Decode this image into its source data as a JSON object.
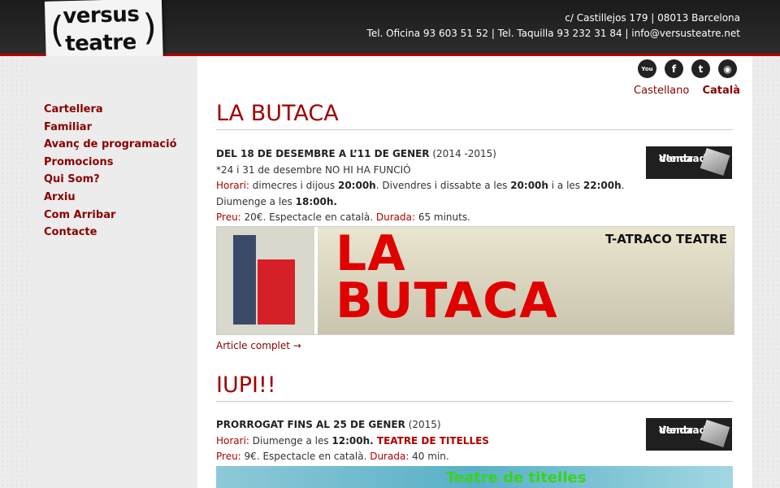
{
  "header": {
    "logo_top": "versus",
    "logo_bottom": "teatre",
    "address": "c/ Castillejos 179 | 08013 Barcelona",
    "phones": "Tel. Oficina 93 603 51 52 | Tel. Taquilla 93 232 31 84 | info@versusteatre.net"
  },
  "social": [
    {
      "icon": "youtube-icon",
      "glyph": "You"
    },
    {
      "icon": "facebook-icon",
      "glyph": "f"
    },
    {
      "icon": "twitter-icon",
      "glyph": "t"
    },
    {
      "icon": "rss-icon",
      "glyph": "◉"
    }
  ],
  "languages": {
    "castellano": "Castellano",
    "catala": "Català"
  },
  "nav": [
    "Cartellera",
    "Familiar",
    "Avanç de programació",
    "Promocions",
    "Qui Som?",
    "Arxiu",
    "Com Arribar",
    "Contacte"
  ],
  "events": [
    {
      "title": "LA BUTACA",
      "dates": "DEL 18 DE DESEMBRE A L’11 DE GENER",
      "years": " (2014 -2015)",
      "note": "*24 i 31 de desembre NO HI HA FUNCIÓ",
      "horari_label": "Horari:",
      "horari_1": " dimecres i dijous ",
      "h1": "20:00h",
      "horari_2": ". Divendres i dissabte  a les ",
      "h2": "20:00h",
      "horari_3": " i a les ",
      "h3": "22:00h",
      "horari_4": ".",
      "diumenge": "Diumenge a les ",
      "h4": "18:00h.",
      "preu_label": "Preu:",
      "preu": " 20€. Espectacle en català. ",
      "durada_label": "Durada:",
      "durada": " 65 minuts.",
      "banner_title_1": "LA",
      "banner_title_2": "BUTACA",
      "banner_company": "T-ATRACO TEATRE",
      "more": "Article complet →"
    },
    {
      "title": "IUPI!!",
      "dates": "PRORROGAT FINS AL 25 DE GENER",
      "years": " (2015)",
      "horari_label": "Horari:",
      "horari_1": " Diumenge a les ",
      "h1": "12:00h.",
      "genre": " TEATRE DE TITELLES",
      "preu_label": "Preu:",
      "preu": " 9€. Espectacle en català. ",
      "durada_label": "Durada:",
      "durada": " 40 min.",
      "banner_text": "Teatre de titelles"
    }
  ],
  "venda": {
    "line1": "Venda",
    "line2": "d’entrades"
  }
}
